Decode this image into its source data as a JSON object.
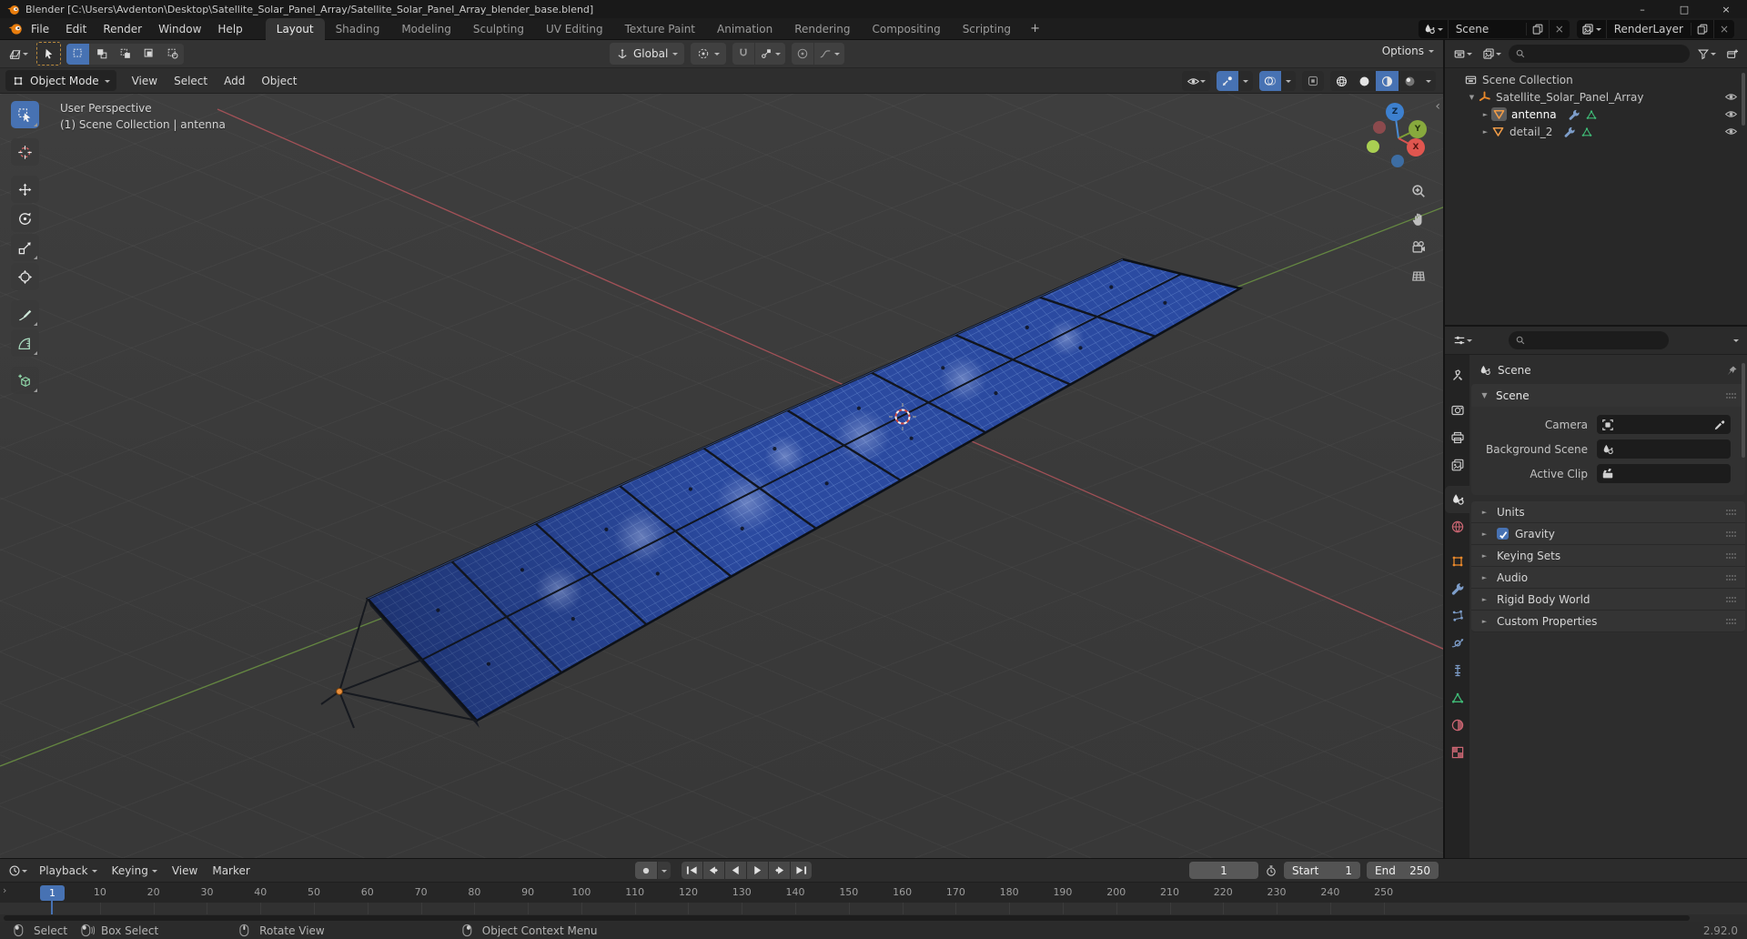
{
  "window": {
    "title": "Blender [C:\\Users\\Avdenton\\Desktop\\Satellite_Solar_Panel_Array/Satellite_Solar_Panel_Array_blender_base.blend]",
    "controls": [
      {
        "name": "minimize",
        "glyph": "–"
      },
      {
        "name": "maximize",
        "glyph": "□"
      },
      {
        "name": "close",
        "glyph": "×"
      }
    ]
  },
  "topbar": {
    "menus": [
      "File",
      "Edit",
      "Render",
      "Window",
      "Help"
    ],
    "workspace_tabs": [
      "Layout",
      "Shading",
      "Modeling",
      "Sculpting",
      "UV Editing",
      "Texture Paint",
      "Animation",
      "Rendering",
      "Compositing",
      "Scripting"
    ],
    "active_tab": "Layout",
    "add_tab_label": "+",
    "scene_name": "Scene",
    "render_layer_name": "RenderLayer"
  },
  "tool_settings": {
    "select_modes": [
      "set",
      "extend",
      "subtract",
      "invert",
      "intersect"
    ],
    "active_select_mode": "set",
    "orientation": "Global",
    "options_label": "Options"
  },
  "viewport_header": {
    "mode": "Object Mode",
    "menus": [
      "View",
      "Select",
      "Add",
      "Object"
    ],
    "shading_modes": [
      "wireframe",
      "solid",
      "material-preview",
      "rendered"
    ],
    "active_shading": "material-preview"
  },
  "viewport": {
    "overlay_line1": "User Perspective",
    "overlay_line2": "(1) Scene Collection | antenna",
    "gizmo": {
      "x": "X",
      "y": "Y",
      "z": "Z"
    },
    "tools": [
      "select-box",
      "cursor",
      "move",
      "rotate",
      "scale",
      "transform",
      "annotate",
      "measure",
      "add-cube"
    ],
    "active_tool": "select-box",
    "nav_icons": [
      "zoom",
      "pan",
      "camera-view",
      "toggle-ortho"
    ]
  },
  "outliner": {
    "search_placeholder": "",
    "items": [
      {
        "label": "Scene Collection",
        "icon": "collection",
        "depth": 0,
        "expander": "none",
        "eye": false,
        "active": false,
        "badges": []
      },
      {
        "label": "Satellite_Solar_Panel_Array",
        "icon": "empty-axes",
        "depth": 1,
        "expander": "open",
        "eye": true,
        "active": false,
        "badges": []
      },
      {
        "label": "antenna",
        "icon": "mesh",
        "depth": 2,
        "expander": "closed",
        "eye": true,
        "active": true,
        "badges": [
          "modifier",
          "mesh-data"
        ]
      },
      {
        "label": "detail_2",
        "icon": "mesh",
        "depth": 2,
        "expander": "closed",
        "eye": true,
        "active": false,
        "badges": [
          "modifier",
          "mesh-data"
        ]
      }
    ]
  },
  "properties": {
    "tabs": [
      "tool",
      "render",
      "output",
      "view-layer",
      "scene",
      "world",
      "object",
      "modifiers",
      "particles",
      "physics",
      "constraints",
      "object-data",
      "material",
      "texture"
    ],
    "active_tab": "scene",
    "breadcrumb": "Scene",
    "scene_panel": {
      "title": "Scene",
      "fields": [
        {
          "label": "Camera",
          "icon": "camera",
          "eyedropper": true,
          "value": ""
        },
        {
          "label": "Background Scene",
          "icon": "scene",
          "eyedropper": false,
          "value": ""
        },
        {
          "label": "Active Clip",
          "icon": "movie-clip",
          "eyedropper": false,
          "value": ""
        }
      ]
    },
    "collapsed_panels": [
      {
        "title": "Units",
        "checkbox": false,
        "checked": false
      },
      {
        "title": "Gravity",
        "checkbox": true,
        "checked": true
      },
      {
        "title": "Keying Sets",
        "checkbox": false,
        "checked": false
      },
      {
        "title": "Audio",
        "checkbox": false,
        "checked": false
      },
      {
        "title": "Rigid Body World",
        "checkbox": false,
        "checked": false
      },
      {
        "title": "Custom Properties",
        "checkbox": false,
        "checked": false
      }
    ]
  },
  "timeline": {
    "menus": [
      "Playback",
      "Keying",
      "View",
      "Marker"
    ],
    "current_frame": "1",
    "frame_ticks": [
      10,
      20,
      30,
      40,
      50,
      60,
      70,
      80,
      90,
      100,
      110,
      120,
      130,
      140,
      150,
      160,
      170,
      180,
      190,
      200,
      210,
      220,
      230,
      240,
      250
    ],
    "start_label": "Start",
    "start_value": "1",
    "end_label": "End",
    "end_value": "250",
    "transport": [
      "jump-start",
      "prev-keyframe",
      "play-reverse",
      "play",
      "next-keyframe",
      "jump-end"
    ]
  },
  "statusbar": {
    "hints": [
      {
        "icon": "mouse-left",
        "label": "Select"
      },
      {
        "icon": "mouse-left-drag",
        "label": "Box Select"
      },
      {
        "icon": "mouse-middle",
        "label": "Rotate View"
      },
      {
        "icon": "mouse-right",
        "label": "Object Context Menu"
      }
    ],
    "version": "2.92.0"
  },
  "colors": {
    "accent_blue": "#4772b3",
    "object_orange": "#e8882a",
    "axis_x_red": "#c4474d",
    "axis_y_green": "#6ca21e",
    "axis_z_blue": "#3d7fd0",
    "mesh_green": "#3fba76",
    "panel_blue": "#2d4ea8"
  }
}
